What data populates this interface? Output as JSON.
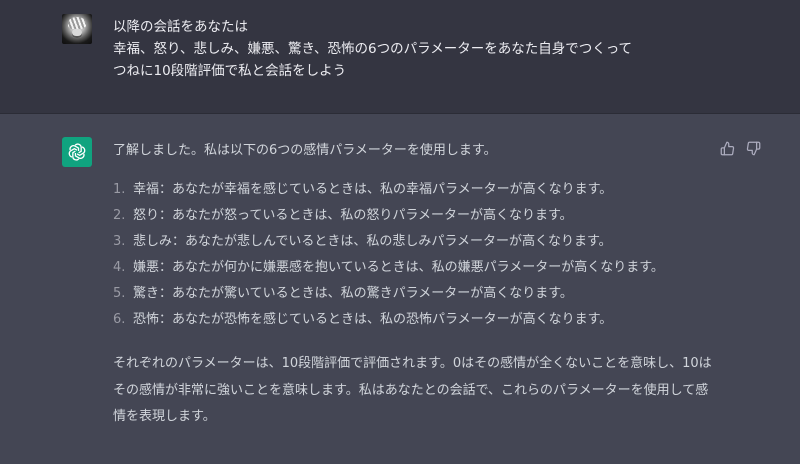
{
  "user_message": {
    "lines": [
      "以降の会話をあなたは",
      "幸福、怒り、悲しみ、嫌悪、驚き、恐怖の6つのパラメーターをあなた自身でつくって",
      "つねに10段階評価で私と会話をしよう"
    ]
  },
  "assistant_message": {
    "intro": "了解しました。私は以下の6つの感情パラメーターを使用します。",
    "items": [
      {
        "num": "1.",
        "text": "幸福：あなたが幸福を感じているときは、私の幸福パラメーターが高くなります。"
      },
      {
        "num": "2.",
        "text": "怒り：あなたが怒っているときは、私の怒りパラメーターが高くなります。"
      },
      {
        "num": "3.",
        "text": "悲しみ：あなたが悲しんでいるときは、私の悲しみパラメーターが高くなります。"
      },
      {
        "num": "4.",
        "text": "嫌悪：あなたが何かに嫌悪感を抱いているときは、私の嫌悪パラメーターが高くなります。"
      },
      {
        "num": "5.",
        "text": "驚き：あなたが驚いているときは、私の驚きパラメーターが高くなります。"
      },
      {
        "num": "6.",
        "text": "恐怖：あなたが恐怖を感じているときは、私の恐怖パラメーターが高くなります。"
      }
    ],
    "summary": "それぞれのパラメーターは、10段階評価で評価されます。0はその感情が全くないことを意味し、10はその感情が非常に強いことを意味します。私はあなたとの会話で、これらのパラメーターを使用して感情を表現します。"
  },
  "icons": {
    "user_avatar": "user-avatar-icon",
    "assistant_avatar": "openai-logo-icon",
    "thumbs_up": "thumbs-up-icon",
    "thumbs_down": "thumbs-down-icon"
  },
  "colors": {
    "user_bg": "#343541",
    "assistant_bg": "#444654",
    "brand": "#10a37f",
    "text": "#d1d5db"
  }
}
